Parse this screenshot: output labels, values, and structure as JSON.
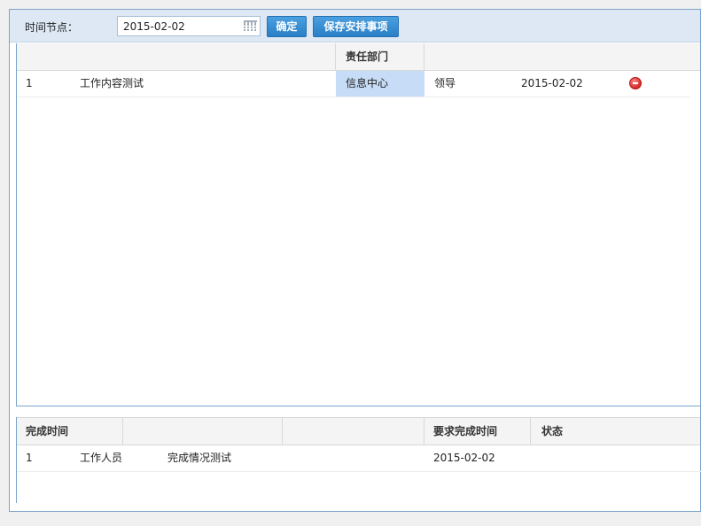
{
  "toolbar": {
    "time_label": "时间节点：",
    "date_value": "2015-02-02",
    "confirm_label": "确定",
    "save_label": "保存安排事项"
  },
  "grid_tasks": {
    "headers": [
      "",
      "",
      "责任部门",
      ""
    ],
    "rows": [
      {
        "index": "1",
        "content": "工作内容测试",
        "department": "信息中心",
        "person": "领导",
        "date": "2015-02-02"
      }
    ]
  },
  "grid_completion": {
    "headers": [
      "完成时间",
      "",
      "",
      "要求完成时间",
      "状态"
    ],
    "rows": [
      {
        "index": "1",
        "worker": "工作人员",
        "description": "完成情况测试",
        "required_date": "2015-02-02",
        "status": ""
      }
    ]
  },
  "colors": {
    "accent": "#2a7fc6",
    "highlight": "#c7ddf7",
    "toolbar_bg": "#dde8f4"
  }
}
